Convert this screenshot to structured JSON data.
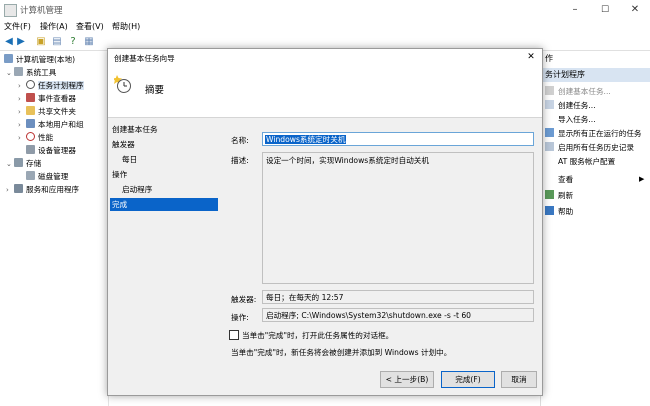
{
  "window": {
    "title": "计算机管理",
    "controls": {
      "minimize": "–",
      "maximize": "☐",
      "close": "✕"
    }
  },
  "menubar": [
    "文件(F)",
    "操作(A)",
    "查看(V)",
    "帮助(H)"
  ],
  "tree": {
    "root": "计算机管理(本地)",
    "items": [
      {
        "label": "系统工具"
      },
      {
        "label": "任务计划程序"
      },
      {
        "label": "事件查看器"
      },
      {
        "label": "共享文件夹"
      },
      {
        "label": "本地用户和组"
      },
      {
        "label": "性能"
      },
      {
        "label": "设备管理器"
      },
      {
        "label": "存储"
      },
      {
        "label": "磁盘管理"
      },
      {
        "label": "服务和应用程序"
      }
    ]
  },
  "actions": {
    "header": "作",
    "section": "务计划程序",
    "items": [
      {
        "label": "创建基本任务...",
        "disabled": true
      },
      {
        "label": "创建任务..."
      },
      {
        "label": "导入任务..."
      },
      {
        "label": "显示所有正在运行的任务"
      },
      {
        "label": "启用所有任务历史记录"
      },
      {
        "label": "AT 服务帐户配置"
      },
      {
        "label": "查看"
      },
      {
        "label": "刷新"
      },
      {
        "label": "帮助"
      }
    ]
  },
  "dialog": {
    "title": "创建基本任务向导",
    "close": "✕",
    "header": "摘要",
    "steps": [
      "创建基本任务",
      "触发器",
      "每日",
      "操作",
      "启动程序",
      "完成"
    ],
    "name_label": "名称:",
    "name_value": "Windows系统定时关机",
    "desc_label": "描述:",
    "desc_value": "设定一个时间，实现Windows系统定时自动关机",
    "trigger_label": "触发器:",
    "trigger_value": "每日；在每天的 12:57",
    "action_label": "操作:",
    "action_value": "启动程序; C:\\Windows\\System32\\shutdown.exe -s -t 60",
    "checkbox_label": "当单击\"完成\"时，打开此任务属性的对话框。",
    "note": "当单击\"完成\"时，新任务将会被创建并添加到 Windows 计划中。",
    "buttons": {
      "back": "< 上一步(B)",
      "finish": "完成(F)",
      "cancel": "取消"
    }
  },
  "colors": {
    "accent": "#0a64c9",
    "selection_bg": "#d8e4f2"
  }
}
